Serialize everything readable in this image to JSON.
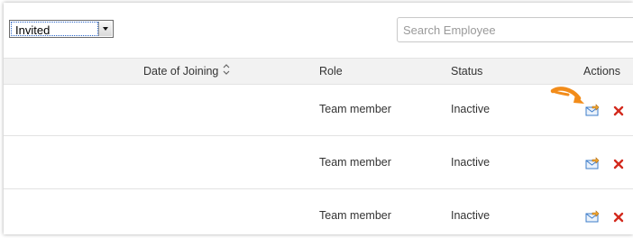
{
  "filter": {
    "selected": "Invited"
  },
  "search": {
    "placeholder": "Search Employee",
    "value": ""
  },
  "table": {
    "headers": {
      "date_of_joining": "Date of Joining",
      "role": "Role",
      "status": "Status",
      "actions": "Actions"
    },
    "rows": [
      {
        "role": "Team member",
        "status": "Inactive"
      },
      {
        "role": "Team member",
        "status": "Inactive"
      },
      {
        "role": "Team member",
        "status": "Inactive"
      }
    ]
  },
  "icons": {
    "sort": "sort-icon",
    "resend": "resend-invite-icon",
    "delete": "delete-icon",
    "pointer": "pointer-arrow-icon"
  },
  "colors": {
    "header_bg": "#f2f2f2",
    "delete_red": "#d32a1e",
    "pointer_orange": "#f28c1a",
    "envelope_blue": "#3d7cc9"
  }
}
